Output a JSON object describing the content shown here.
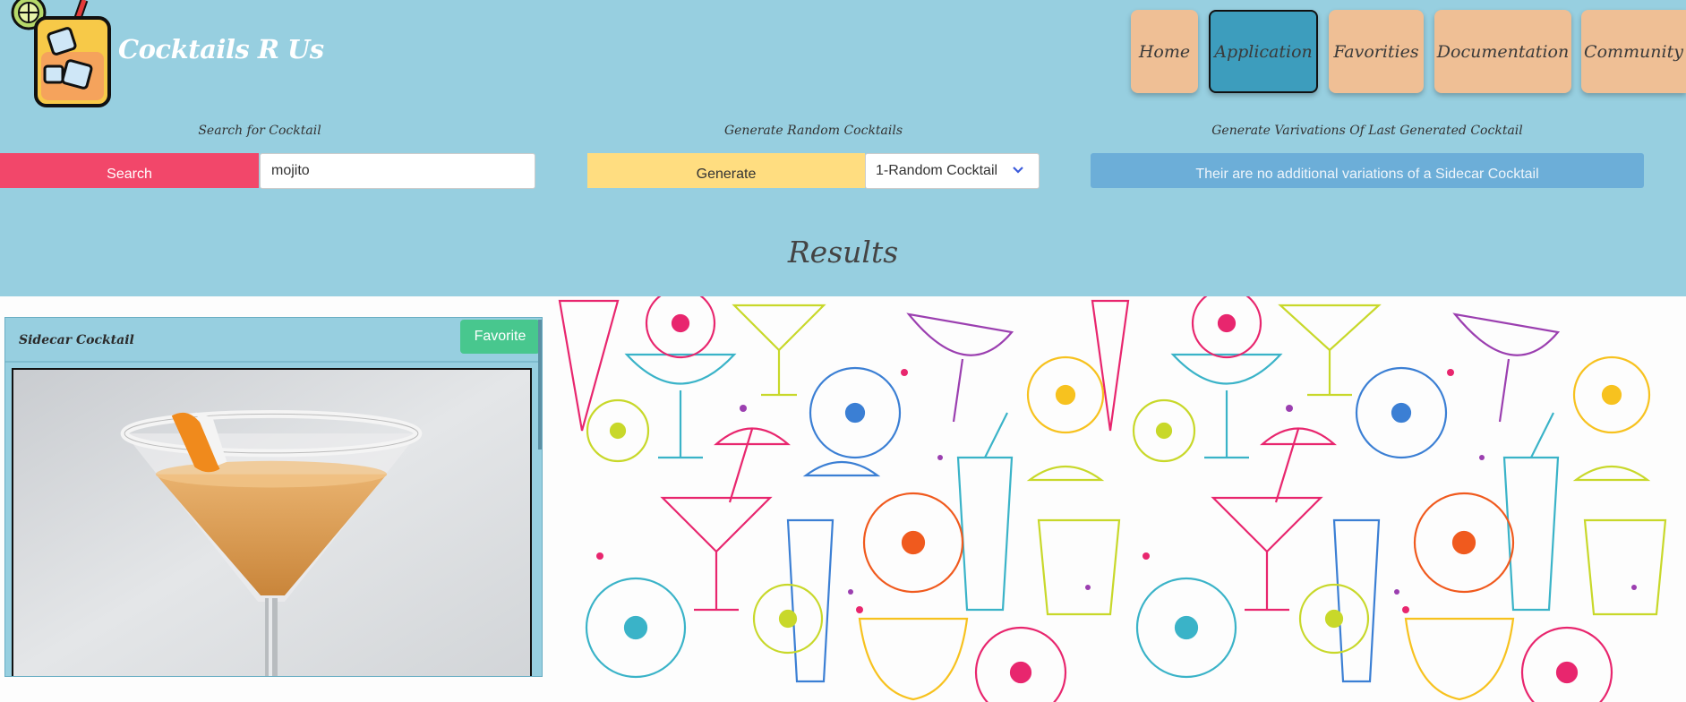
{
  "brand": {
    "name": "Cocktails R Us"
  },
  "nav": {
    "items": [
      {
        "label": "Home",
        "active": false
      },
      {
        "label": "Application",
        "active": true
      },
      {
        "label": "Favorities",
        "active": false
      },
      {
        "label": "Documentation",
        "active": false
      },
      {
        "label": "Community",
        "active": false
      }
    ]
  },
  "search": {
    "heading": "Search for Cocktail",
    "button_label": "Search",
    "value": "mojito",
    "placeholder": ""
  },
  "random": {
    "heading": "Generate Random Cocktails",
    "button_label": "Generate",
    "selected_option": "1-Random Cocktail"
  },
  "variations": {
    "heading": "Generate Varivations Of Last Generated Cocktail",
    "button_label": "Their are no additional variations of a Sidecar Cocktail"
  },
  "results": {
    "heading": "Results",
    "card": {
      "title": "Sidecar Cocktail",
      "favorite_label": "Favorite"
    }
  },
  "colors": {
    "page_bg": "#97cfe0",
    "nav_button": "#efbf95",
    "nav_active": "#3d9dbd",
    "search_button": "#f2476a",
    "generate_button": "#ffdd80",
    "variation_button": "#6caed8",
    "favorite_button": "#48c78e"
  }
}
